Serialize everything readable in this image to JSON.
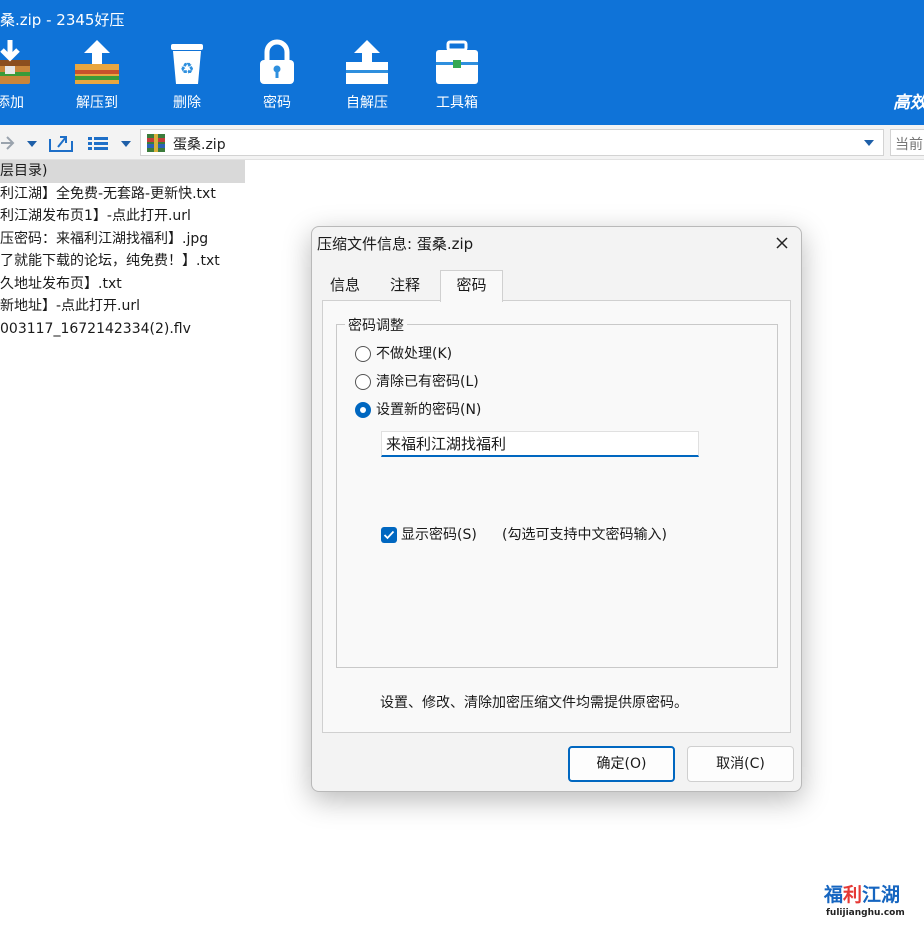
{
  "window": {
    "title": "桑.zip - 2345好压",
    "brand": "高效"
  },
  "toolbar": {
    "items": [
      {
        "label": "添加",
        "icon": "add-archive-icon"
      },
      {
        "label": "解压到",
        "icon": "extract-icon"
      },
      {
        "label": "删除",
        "icon": "recycle-bin-icon"
      },
      {
        "label": "密码",
        "icon": "lock-icon"
      },
      {
        "label": "自解压",
        "icon": "self-extract-icon"
      },
      {
        "label": "工具箱",
        "icon": "toolbox-icon"
      }
    ]
  },
  "addressbar": {
    "path": "蛋桑.zip",
    "search_placeholder": "当前",
    "icons": [
      "forward-arrow-icon",
      "history-dropdown-icon",
      "up-folder-icon",
      "view-mode-icon",
      "view-dropdown-icon",
      "archive-icon",
      "path-dropdown-icon"
    ]
  },
  "files": [
    "层目录)",
    "利江湖】全免费-无套路-更新快.txt",
    "利江湖发布页1】-点此打开.url",
    "压密码：来福利江湖找福利】.jpg",
    "了就能下载的论坛，纯免费！】.txt",
    "久地址发布页】.txt",
    "新地址】-点此打开.url",
    "003117_1672142334(2).flv"
  ],
  "dialog": {
    "title": "压缩文件信息: 蛋桑.zip",
    "tabs": [
      "信息",
      "注释",
      "密码"
    ],
    "active_tab": "密码",
    "group_title": "密码调整",
    "options": [
      {
        "label": "不做处理(K)",
        "checked": false
      },
      {
        "label": "清除已有密码(L)",
        "checked": false
      },
      {
        "label": "设置新的密码(N)",
        "checked": true
      }
    ],
    "password_value": "来福利江湖找福利",
    "show_password": {
      "label": "显示密码(S)",
      "hint": "(勾选可支持中文密码输入)",
      "checked": true
    },
    "note": "设置、修改、清除加密压缩文件均需提供原密码。",
    "ok_label": "确定(O)",
    "cancel_label": "取消(C)"
  },
  "watermark": {
    "main_blue1": "福",
    "main_red": "利",
    "main_blue2": "江湖",
    "sub": "fulijianghu.com"
  },
  "colors": {
    "toolbar_bg": "#0f73d8",
    "accent": "#0067c0",
    "dialog_bg": "#f3f3f3",
    "selected_row": "#d9d9d9"
  }
}
